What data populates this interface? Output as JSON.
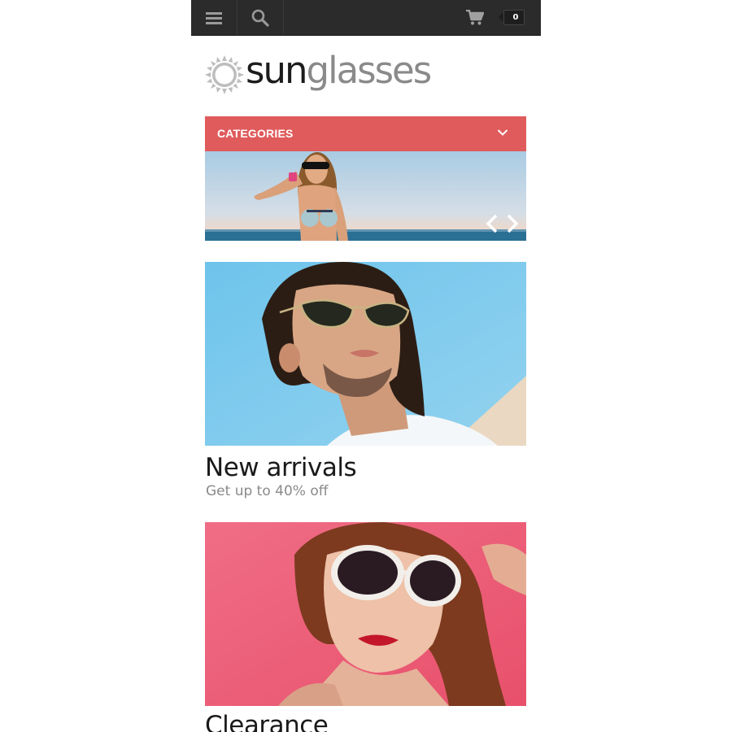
{
  "logo": {
    "text_dark": "sun",
    "text_light": "glasses"
  },
  "header": {
    "cart_count": "0",
    "icons": {
      "menu": "menu-icon",
      "search": "search-icon",
      "cart": "cart-icon"
    }
  },
  "categories": {
    "label": "CATEGORIES",
    "icon": "chevron-down-icon"
  },
  "slider": {
    "prev_icon": "chevron-left-icon",
    "next_icon": "chevron-right-icon"
  },
  "banners": [
    {
      "title": "New arrivals",
      "subtitle": "Get up to 40% off"
    },
    {
      "title": "Clearance"
    }
  ],
  "colors": {
    "topbar": "#2b2b2b",
    "accent": "#e05b5c",
    "logo_dark": "#1c1c1c",
    "logo_light": "#8a8a8a"
  }
}
